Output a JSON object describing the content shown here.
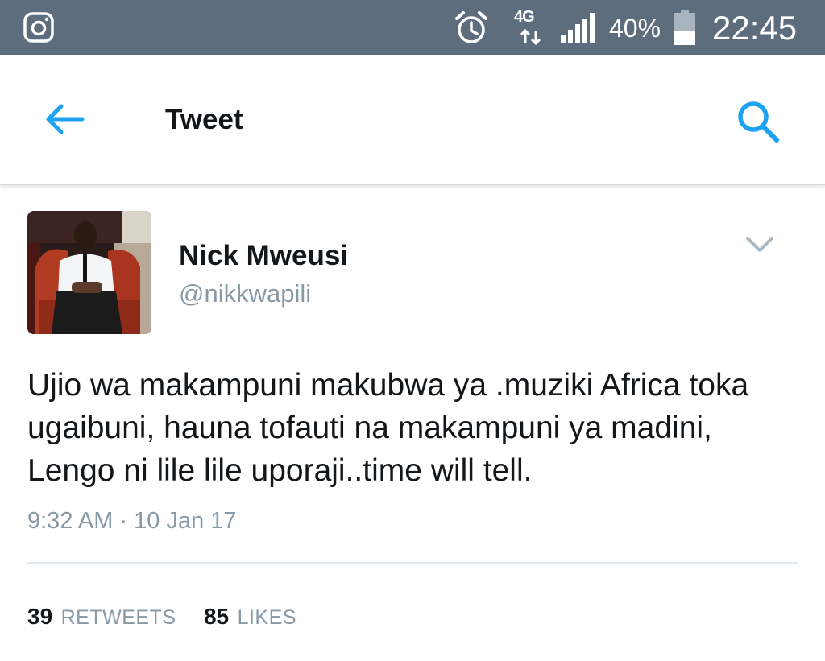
{
  "status_bar": {
    "network": "4G",
    "battery": "40%",
    "time": "22:45",
    "icons": [
      "instagram-icon",
      "alarm-icon",
      "network-4g-icon",
      "signal-icon",
      "battery-icon"
    ],
    "background_color": "#5d6d7e"
  },
  "app_bar": {
    "title": "Tweet",
    "accent_color": "#1da1f2"
  },
  "tweet": {
    "author_name": "Nick Mweusi",
    "author_handle": "@nikkwapili",
    "text": "Ujio wa makampuni makubwa ya .muziki Africa toka ugaibuni, hauna tofauti na makampuni ya madini, Lengo ni lile lile uporaji..time will tell.",
    "timestamp": "9:32 AM · 10 Jan 17",
    "retweets_count": "39",
    "retweets_label": "RETWEETS",
    "likes_count": "85",
    "likes_label": "LIKES"
  }
}
